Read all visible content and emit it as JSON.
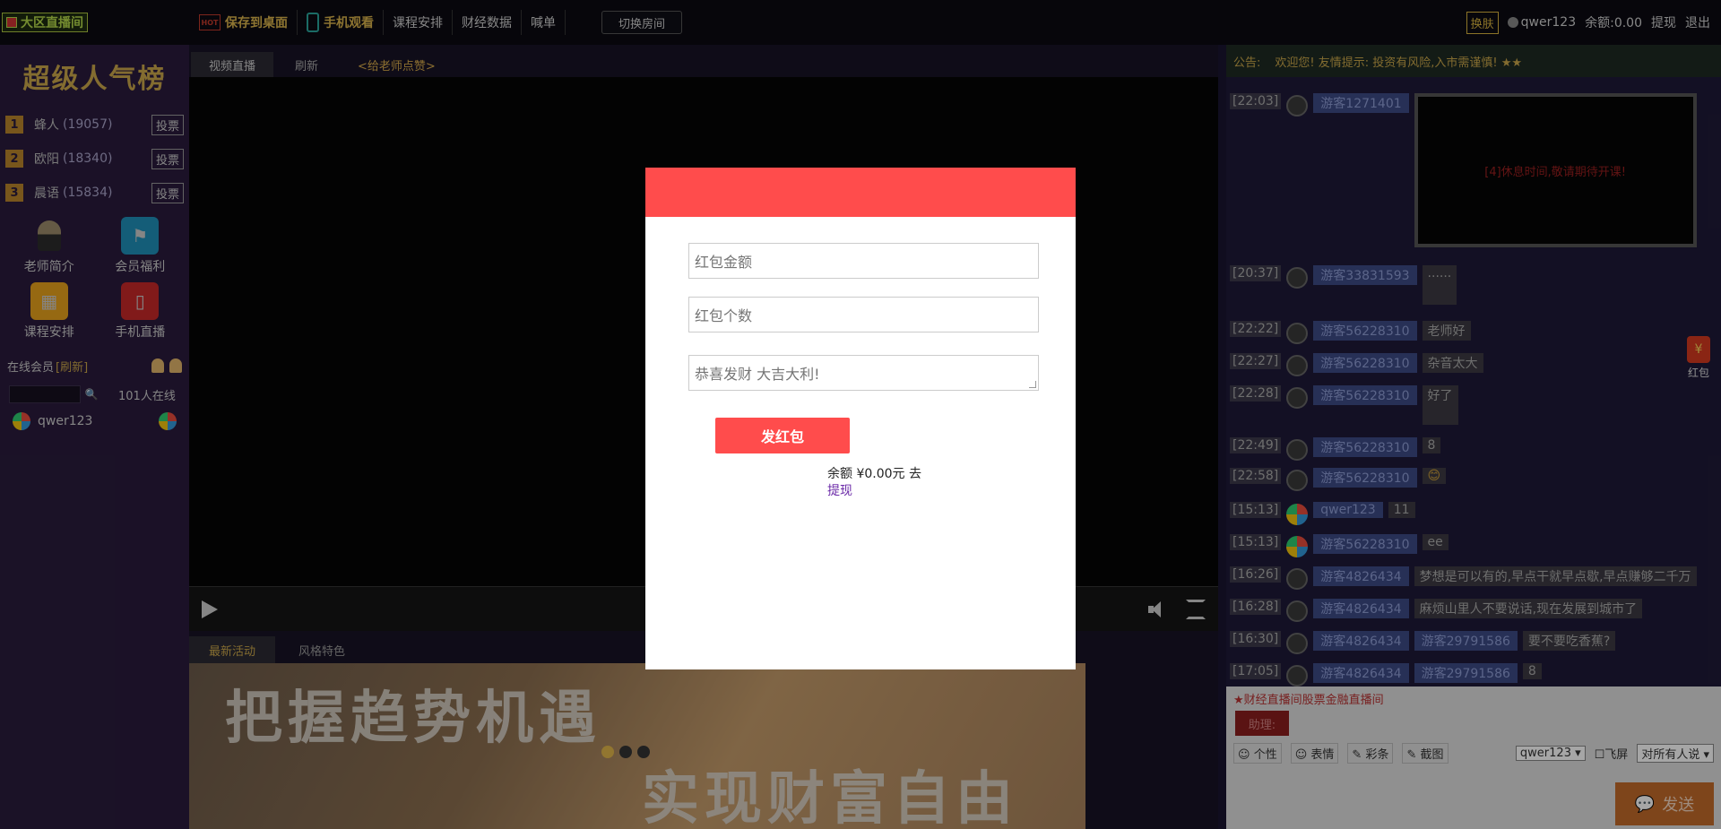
{
  "topbar": {
    "logo": "大区直播间",
    "nav": [
      {
        "label": "保存到桌面",
        "hot": true
      },
      {
        "label": "手机观看"
      },
      {
        "label": "课程安排"
      },
      {
        "label": "财经数据"
      },
      {
        "label": "喊单"
      }
    ],
    "hot_badge": "HOT",
    "switch_room": "切换房间",
    "skin": "换肤",
    "username": "qwer123",
    "balance": "余额:0.00",
    "withdraw": "提现",
    "logout": "退出"
  },
  "sidebar": {
    "title": "超级人气榜",
    "ranking": [
      {
        "rank": "1",
        "name": "蜂人",
        "votes": "(19057)"
      },
      {
        "rank": "2",
        "name": "欧阳",
        "votes": "(18340)"
      },
      {
        "rank": "3",
        "name": "晨语",
        "votes": "(15834)"
      }
    ],
    "vote_label": "投票",
    "quick_links": [
      {
        "label": "老师简介",
        "icon": "teacher-icon"
      },
      {
        "label": "会员福利",
        "icon": "flag-icon"
      },
      {
        "label": "课程安排",
        "icon": "calendar-icon"
      },
      {
        "label": "手机直播",
        "icon": "mobile-icon"
      }
    ],
    "online_title": "在线会员",
    "refresh": "[刷新]",
    "online_count": "101人在线",
    "members": [
      {
        "name": "qwer123"
      }
    ]
  },
  "video": {
    "tabs": [
      "视频直播",
      "刷新",
      "<给老师点赞>"
    ],
    "activity_tabs": [
      "最新活动",
      "风格特色"
    ],
    "banner_line1": "把握趋势机遇",
    "banner_line2": "实现财富自由"
  },
  "chat": {
    "notice_label": "公告:",
    "notice_text": "欢迎您! 友情提示: 投资有风险,入市需谨慎! ★★",
    "screenshot_text": "[4]休息时间,敬请期待开课!",
    "messages": [
      {
        "time": "[22:03]",
        "user": "游客1271401"
      },
      {
        "time": "[20:37]",
        "user": "游客33831593",
        "text": "......"
      },
      {
        "time": "[22:22]",
        "user": "游客56228310",
        "text": "老师好"
      },
      {
        "time": "[22:27]",
        "user": "游客56228310",
        "text": "杂音太大"
      },
      {
        "time": "[22:28]",
        "user": "游客56228310",
        "text": "好了"
      },
      {
        "time": "[22:49]",
        "user": "游客56228310",
        "text": "8"
      },
      {
        "time": "[22:58]",
        "user": "游客56228310",
        "text": "😊"
      },
      {
        "time": "[15:13]",
        "user": "qwer123",
        "text": "11"
      },
      {
        "time": "[15:13]",
        "user": "游客56228310",
        "text": "ee"
      },
      {
        "time": "[16:26]",
        "user": "游客4826434",
        "text": "梦想是可以有的,早点干就早点歇,早点赚够二千万"
      },
      {
        "time": "[16:28]",
        "user": "游客4826434",
        "text": "麻烦山里人不要说话,现在发展到城市了"
      },
      {
        "time": "[16:30]",
        "user": "游客4826434",
        "to": "游客29791586",
        "text": "要不要吃香蕉?"
      },
      {
        "time": "[17:05]",
        "user": "游客4826434",
        "to": "游客29791586",
        "text": "8"
      }
    ],
    "compose_title": "★财经直播间股票金融直播间",
    "assistant": "助理:",
    "tools": [
      "个性",
      "表情",
      "彩条",
      "截图"
    ],
    "recipient_user": "qwer123",
    "flyscreen": "飞屏",
    "audience": "对所有人说",
    "send": "发送",
    "redpack": "红包"
  },
  "modal": {
    "amount_placeholder": "红包金额",
    "count_placeholder": "红包个数",
    "greeting_placeholder": "恭喜发财 大吉大利!",
    "send_label": "发红包",
    "balance_text": "余额 ¥0.00元 去",
    "withdraw_link": "提现"
  }
}
